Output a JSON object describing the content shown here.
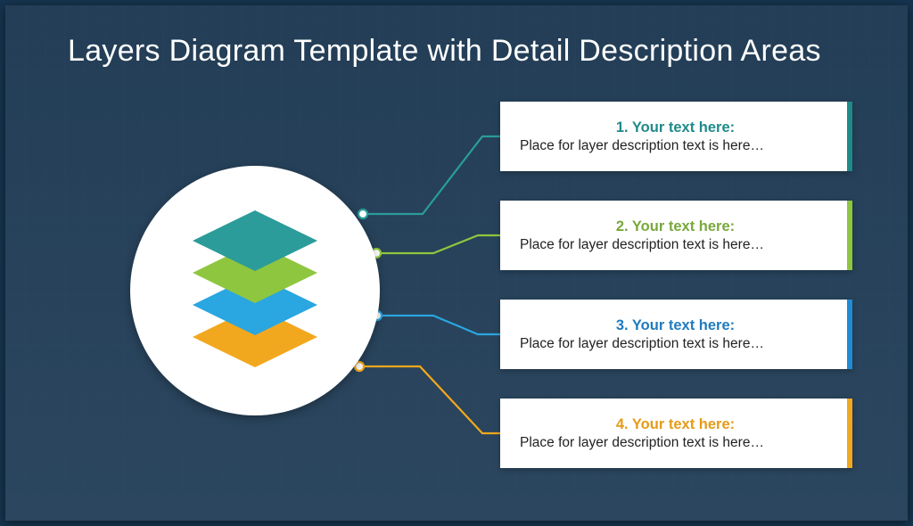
{
  "title": "Layers Diagram Template with Detail Description Areas",
  "colors": {
    "teal": "#2b9c99",
    "green": "#8fc63f",
    "blue": "#2aa6e0",
    "orange": "#f2a81e"
  },
  "layers": [
    {
      "id": 1,
      "color": "teal",
      "title": "1. Your text here:",
      "desc": "Place for layer description text is here…"
    },
    {
      "id": 2,
      "color": "green",
      "title": "2. Your text here:",
      "desc": "Place for layer description text is here…"
    },
    {
      "id": 3,
      "color": "blue",
      "title": "3. Your text here:",
      "desc": "Place for layer description text is here…"
    },
    {
      "id": 4,
      "color": "orange",
      "title": "4. Your text here:",
      "desc": "Place for layer description text is here…"
    }
  ]
}
